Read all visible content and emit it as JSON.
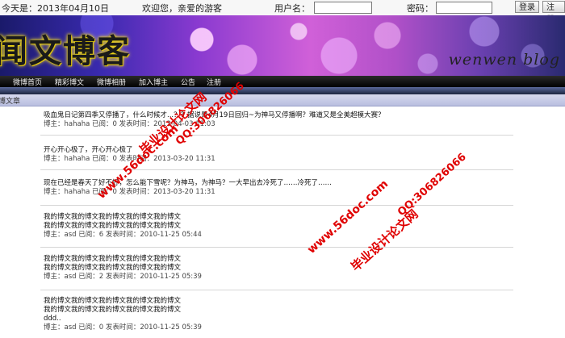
{
  "header": {
    "date_label": "今天是：2013年04月10日",
    "welcome": "欢迎您，亲爱的游客",
    "username_label": "用户名：",
    "password_label": "密码：",
    "username_value": "",
    "password_value": "",
    "login_button": "登录",
    "register_button": "注册"
  },
  "banner": {
    "logo_text": "闻文博客",
    "tagline": "wenwen blog"
  },
  "nav": {
    "items": [
      "微博首页",
      "精彩博文",
      "微博相册",
      "加入博主",
      "公告",
      "注册"
    ]
  },
  "section": {
    "title": "博文章"
  },
  "posts": [
    {
      "title": "吸血鬼日记第四季又停播了，什么时候才...？？据说是4月19日回归~为神马又停播啊？难道又是全美超模大赛？",
      "meta": "博主：hahaha 已阅：0 发表时间：2013-04-03 11:03"
    },
    {
      "title": "开心开心极了，开心开心极了",
      "meta": "博主：hahaha 已阅：0 发表时间：2013-03-20 11:31"
    },
    {
      "title": "现在已经是春天了好不好，怎么能下雪呢？为神马，为神马？一大早出去冷死了……冷死了……",
      "meta": "博主：hahaha 已阅：0 发表时间：2013-03-20 11:31"
    },
    {
      "lines": [
        "我的博文我的博文我的博文我的博文我的博文",
        "我的博文我的博文我的博文我的博文我的博文"
      ],
      "meta": "博主：asd 已阅：6 发表时间：2010-11-25 05:44"
    },
    {
      "lines": [
        "我的博文我的博文我的博文我的博文我的博文",
        "我的博文我的博文我的博文我的博文我的博文"
      ],
      "meta": "博主：asd 已阅：2 发表时间：2010-11-25 05:39"
    },
    {
      "lines": [
        "我的博文我的博文我的博文我的博文我的博文",
        "我的博文我的博文我的博文我的博文我的博文",
        "ddd.."
      ],
      "meta": "博主：asd 已阅：0 发表时间：2010-11-25 05:39"
    }
  ],
  "watermarks": {
    "site": "www.56doc.com",
    "qq": "QQ:306826066",
    "cn": "毕业设计论文网"
  },
  "colors": {
    "nav_bg": "#000000",
    "section_bar": "#c4c8e6",
    "watermark": "#e00000"
  }
}
